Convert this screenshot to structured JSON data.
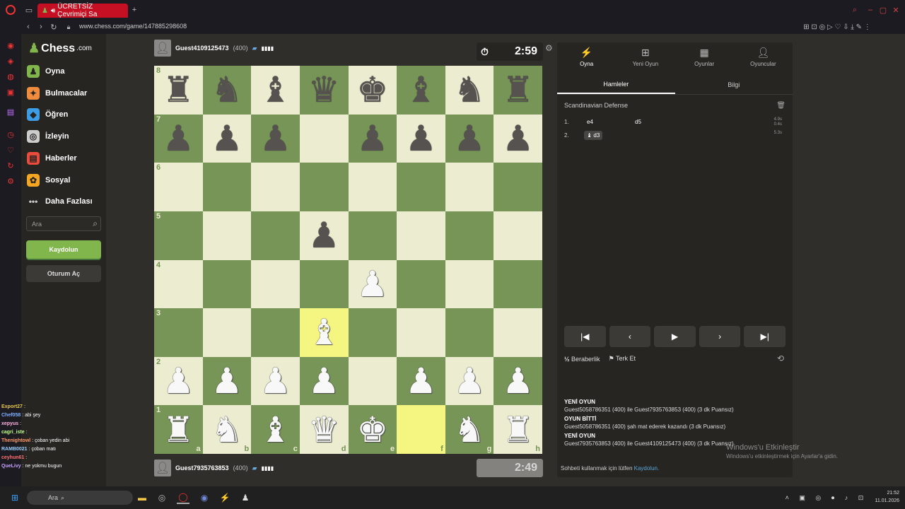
{
  "browser": {
    "tab_title": "ÜCRETSİZ Çevrimiçi Sa",
    "url": "www.chess.com/game/147885298608"
  },
  "sidebar": {
    "logo_text": "Chess",
    "logo_suffix": ".com",
    "items": [
      {
        "label": "Oyna",
        "icon": "play-icon",
        "color": "#81b64c"
      },
      {
        "label": "Bulmacalar",
        "icon": "puzzle-icon",
        "color": "#f18b3d"
      },
      {
        "label": "Öğren",
        "icon": "learn-icon",
        "color": "#3d9ce6"
      },
      {
        "label": "İzleyin",
        "icon": "binoculars-icon",
        "color": "#cccccc"
      },
      {
        "label": "Haberler",
        "icon": "news-icon",
        "color": "#e94b3c"
      },
      {
        "label": "Sosyal",
        "icon": "social-icon",
        "color": "#f5a623"
      },
      {
        "label": "Daha Fazlası",
        "icon": "more-icon",
        "color": "#cccccc"
      }
    ],
    "search_placeholder": "Ara",
    "signup_label": "Kaydolun",
    "login_label": "Oturum Aç"
  },
  "top_player": {
    "name": "Guest4109125473",
    "rating": "(400)",
    "clock": "2:59"
  },
  "bottom_player": {
    "name": "Guest7935763853",
    "rating": "(400)",
    "clock": "2:49"
  },
  "board": {
    "ranks": [
      "8",
      "7",
      "6",
      "5",
      "4",
      "3",
      "2",
      "1"
    ],
    "files": [
      "a",
      "b",
      "c",
      "d",
      "e",
      "f",
      "g",
      "h"
    ],
    "highlight": [
      "d3",
      "f1"
    ],
    "position": [
      [
        "bR",
        "bN",
        "bB",
        "bQ",
        "bK",
        "bB",
        "bN",
        "bR"
      ],
      [
        "bP",
        "bP",
        "bP",
        "",
        "bP",
        "bP",
        "bP",
        "bP"
      ],
      [
        "",
        "",
        "",
        "",
        "",
        "",
        "",
        ""
      ],
      [
        "",
        "",
        "",
        "bP",
        "",
        "",
        "",
        ""
      ],
      [
        "",
        "",
        "",
        "",
        "wP",
        "",
        "",
        ""
      ],
      [
        "",
        "",
        "",
        "wB",
        "",
        "",
        "",
        ""
      ],
      [
        "wP",
        "wP",
        "wP",
        "wP",
        "",
        "wP",
        "wP",
        "wP"
      ],
      [
        "wR",
        "wN",
        "wB",
        "wQ",
        "wK",
        "",
        "wN",
        "wR"
      ]
    ]
  },
  "panel": {
    "tabs": [
      {
        "label": "Oyna",
        "icon": "bolt-icon"
      },
      {
        "label": "Yeni Oyun",
        "icon": "plus-icon"
      },
      {
        "label": "Oyunlar",
        "icon": "board-icon"
      },
      {
        "label": "Oyuncular",
        "icon": "players-icon"
      }
    ],
    "subtabs": [
      "Hamleler",
      "Bilgi"
    ],
    "opening": "Scandinavian Defense",
    "moves": [
      {
        "no": "1.",
        "white": "e4",
        "black": "d5",
        "time_w": "4.9s",
        "time_b": "0.4s"
      },
      {
        "no": "2.",
        "white": "d3",
        "black": "",
        "time_w": "5.3s"
      }
    ],
    "draw_label": "Beraberlik",
    "resign_label": "Terk Et",
    "chat": [
      {
        "heading": "YENİ OYUN",
        "text": "Guest5058786351 (400) ile Guest7935763853 (400) (3 dk Puansız)"
      },
      {
        "heading": "OYUN BİTTİ",
        "text": "Guest5058786351 (400) şah mat ederek kazandı (3 dk Puansız)"
      },
      {
        "heading": "YENİ OYUN",
        "text": "Guest7935763853 (400) ile Guest4109125473 (400) (3 dk Puansız)"
      }
    ],
    "signup_prompt": "Sohbeti kullanmak için lütfen ",
    "signup_link": "Kaydolun."
  },
  "watermark": {
    "title": "Windows'u Etkinleştir",
    "subtitle": "Windows'u etkinleştirmek için Ayarlar'a gidin."
  },
  "stream_overlay": [
    {
      "user": "Export27",
      "msg": ":",
      "color": "#e6c84a"
    },
    {
      "user": "Chef058",
      "msg": ": abi şey",
      "color": "#7fb0ff"
    },
    {
      "user": "xepyus",
      "msg": ":",
      "color": "#ffb3e0"
    },
    {
      "user": "cagri_iste",
      "msg": ":",
      "color": "#c0ff8a"
    },
    {
      "user": "Thenightowl",
      "msg": ": çoban yedin abi",
      "color": "#ff9966"
    },
    {
      "user": "RAMB0021",
      "msg": ": çoban matı",
      "color": "#9ad1ff"
    },
    {
      "user": "ceyhun61",
      "msg": ":",
      "color": "#ff7070"
    },
    {
      "user": "QueLivy",
      "msg": ": ne yokmu bugun",
      "color": "#c9a0ff"
    }
  ],
  "taskbar": {
    "search_placeholder": "Ara",
    "time": "21:52",
    "date": "11.01.2026"
  }
}
